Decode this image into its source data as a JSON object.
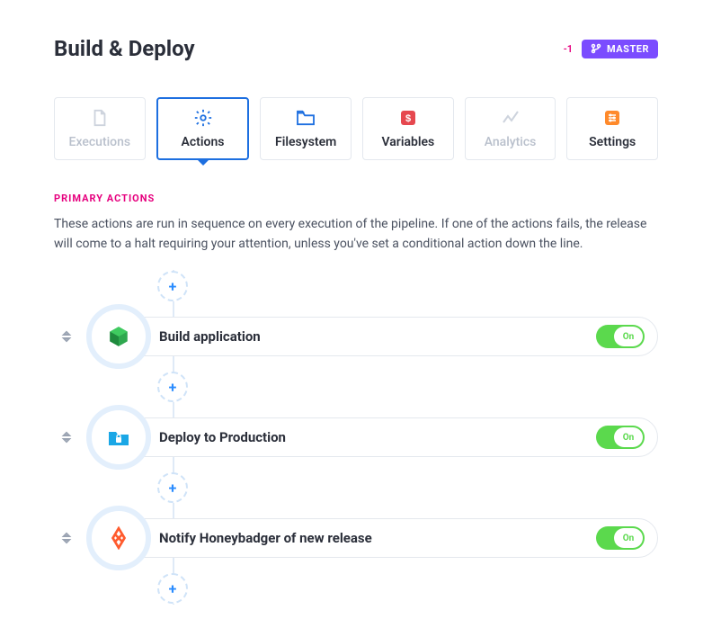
{
  "header": {
    "title": "Build & Deploy",
    "counter": "-1",
    "branch_label": "MASTER"
  },
  "tabs": [
    {
      "id": "executions",
      "label": "Executions",
      "enabled": false
    },
    {
      "id": "actions",
      "label": "Actions",
      "enabled": true,
      "active": true
    },
    {
      "id": "filesystem",
      "label": "Filesystem",
      "enabled": true
    },
    {
      "id": "variables",
      "label": "Variables",
      "enabled": true
    },
    {
      "id": "analytics",
      "label": "Analytics",
      "enabled": false
    },
    {
      "id": "settings",
      "label": "Settings",
      "enabled": true
    }
  ],
  "section": {
    "label": "PRIMARY ACTIONS",
    "description": "These actions are run in sequence on every execution of the pipeline. If one of the actions fails, the release will come to a halt requiring your attention, unless you've set a conditional action down the line."
  },
  "actions": [
    {
      "title": "Build application",
      "toggle": "On",
      "icon": "cube",
      "icon_color": "#2fa84f"
    },
    {
      "title": "Deploy to Production",
      "toggle": "On",
      "icon": "folder-lock",
      "icon_color": "#1aa7e6"
    },
    {
      "title": "Notify Honeybadger of new release",
      "toggle": "On",
      "icon": "honeybadger",
      "icon_color": "#ff5b2e"
    }
  ],
  "add_button": "+",
  "toggle_on_label": "On"
}
